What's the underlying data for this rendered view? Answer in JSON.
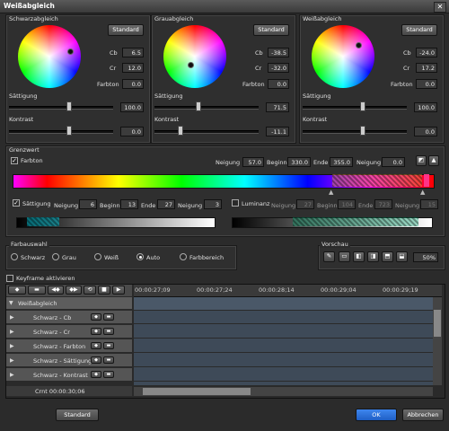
{
  "window": {
    "title": "Weißabgleich",
    "close_glyph": "✕"
  },
  "wheels": [
    {
      "title": "Schwarzabgleich",
      "standard_label": "Standard",
      "cb_label": "Cb",
      "cb_value": "6.5",
      "cr_label": "Cr",
      "cr_value": "12.0",
      "hue_label": "Farbton",
      "hue_value": "0.0",
      "sat_label": "Sättigung",
      "sat_value": "100.0",
      "contrast_label": "Kontrast",
      "contrast_value": "0.0"
    },
    {
      "title": "Grauabgleich",
      "standard_label": "Standard",
      "cb_label": "Cb",
      "cb_value": "-38.5",
      "cr_label": "Cr",
      "cr_value": "-32.0",
      "hue_label": "Farbton",
      "hue_value": "0.0",
      "sat_label": "Sättigung",
      "sat_value": "71.5",
      "contrast_label": "Kontrast",
      "contrast_value": "-11.1"
    },
    {
      "title": "Weißabgleich",
      "standard_label": "Standard",
      "cb_label": "Cb",
      "cb_value": "-24.0",
      "cr_label": "Cr",
      "cr_value": "17.2",
      "hue_label": "Farbton",
      "hue_value": "0.0",
      "sat_label": "Sättigung",
      "sat_value": "100.0",
      "contrast_label": "Kontrast",
      "contrast_value": "0.0"
    }
  ],
  "grenzwert": {
    "title": "Grenzwert",
    "farbton": {
      "label": "Farbton",
      "checked": true,
      "neigung1_label": "Neigung",
      "neigung1": "57.0",
      "beginn_label": "Beginn",
      "beginn": "330.0",
      "ende_label": "Ende",
      "ende": "355.0",
      "neigung2_label": "Neigung",
      "neigung2": "0.0"
    },
    "saettigung": {
      "label": "Sättigung",
      "checked": true,
      "neigung1_label": "Neigung",
      "neigung1": "6",
      "beginn_label": "Beginn",
      "beginn": "13",
      "ende_label": "Ende",
      "ende": "27",
      "neigung2_label": "Neigung",
      "neigung2": "3"
    },
    "luminanz": {
      "label": "Luminanz",
      "checked": false,
      "neigung1_label": "Neigung",
      "neigung1": "27",
      "beginn_label": "Beginn",
      "beginn": "104",
      "ende_label": "Ende",
      "ende": "723",
      "neigung2_label": "Neigung",
      "neigung2": "15"
    }
  },
  "farbauswahl": {
    "title": "Farbauswahl",
    "options": [
      "Schwarz",
      "Grau",
      "Weiß",
      "Auto",
      "Farbbereich"
    ],
    "selected": "Auto"
  },
  "vorschau": {
    "title": "Vorschau",
    "zoom": "50%"
  },
  "keyframe": {
    "label": "Keyframe aktivieren",
    "checked": false
  },
  "timeline": {
    "ruler": [
      "00:00:27;09",
      "00:00:27;24",
      "00:00:28;14",
      "00:00:29;04",
      "00:00:29;19"
    ],
    "group": "Weißabgleich",
    "tracks": [
      "Schwarz - Cb",
      "Schwarz - Cr",
      "Schwarz - Farbton",
      "Schwarz - Sättigung",
      "Schwarz - Kontrast"
    ],
    "current_time": "Crnt 00:00:30;06"
  },
  "footer": {
    "standard": "Standard",
    "ok": "OK",
    "abbrechen": "Abbrechen"
  },
  "colors": {
    "ok_button": "#2a6fd6",
    "background": "#2b2b2b"
  }
}
